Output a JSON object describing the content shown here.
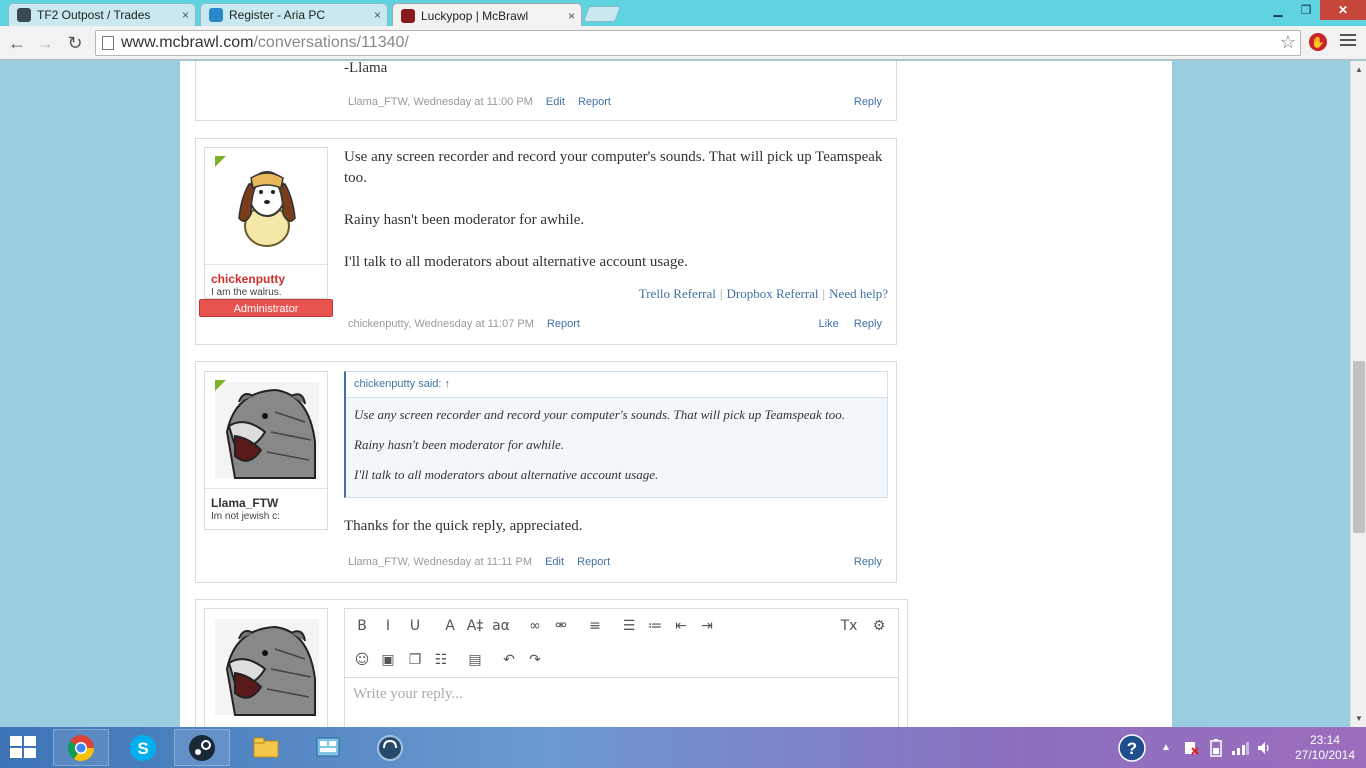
{
  "browser": {
    "tabs": [
      {
        "title": "TF2 Outpost / Trades",
        "active": false
      },
      {
        "title": "Register - Aria PC",
        "active": false
      },
      {
        "title": "Luckypop | McBrawl",
        "active": true
      }
    ],
    "tab_close_glyph": "×",
    "url_host": "www.mcbrawl.com",
    "url_path": "/conversations/11340/"
  },
  "posts": [
    {
      "body_tail": "-Llama",
      "meta_author_time": "Llama_FTW, Wednesday at 11:00 PM",
      "edit_label": "Edit",
      "report_label": "Report",
      "reply_label": "Reply"
    },
    {
      "username": "chickenputty",
      "user_title": "I am the walrus.",
      "user_badge": "Administrator",
      "paragraphs": [
        "Use any screen recorder and record your computer's sounds. That will pick up Teamspeak too.",
        "Rainy hasn't been moderator for awhile.",
        "I'll talk to all moderators about alternative account usage."
      ],
      "signature": [
        "Trello Referral",
        "Dropbox Referral",
        "Need help?"
      ],
      "signature_sep": "|",
      "meta_author_time": "chickenputty, Wednesday at 11:07 PM",
      "report_label": "Report",
      "like_label": "Like",
      "reply_label": "Reply"
    },
    {
      "username": "Llama_FTW",
      "user_title": "Im not jewish c:",
      "quote_author": "chickenputty said:",
      "quote_arrow": "↑",
      "quote_paragraphs": [
        "Use any screen recorder and record your computer's sounds. That will pick up Teamspeak too.",
        "Rainy hasn't been moderator for awhile.",
        "I'll talk to all moderators about alternative account usage."
      ],
      "body": "Thanks for the quick reply, appreciated.",
      "meta_author_time": "Llama_FTW, Wednesday at 11:11 PM",
      "edit_label": "Edit",
      "report_label": "Report",
      "reply_label": "Reply"
    }
  ],
  "editor": {
    "placeholder": "Write your reply...",
    "toolbar_row1": [
      {
        "name": "bold-icon",
        "glyph": "B"
      },
      {
        "name": "italic-icon",
        "glyph": "I"
      },
      {
        "name": "underline-icon",
        "glyph": "U"
      },
      {
        "name": "font-color-icon",
        "glyph": "A"
      },
      {
        "name": "font-size-icon",
        "glyph": "A‡"
      },
      {
        "name": "font-family-icon",
        "glyph": "aα"
      },
      {
        "name": "link-icon",
        "glyph": "∞"
      },
      {
        "name": "unlink-icon",
        "glyph": "⚮"
      },
      {
        "name": "align-icon",
        "glyph": "≡"
      },
      {
        "name": "bullet-list-icon",
        "glyph": "☰"
      },
      {
        "name": "numbered-list-icon",
        "glyph": "≔"
      },
      {
        "name": "outdent-icon",
        "glyph": "⇤"
      },
      {
        "name": "indent-icon",
        "glyph": "⇥"
      },
      {
        "name": "remove-format-icon",
        "glyph": "Tx"
      },
      {
        "name": "toggle-bbcode-icon",
        "glyph": "⚙"
      }
    ],
    "toolbar_row2": [
      {
        "name": "smilies-icon",
        "glyph": "☺"
      },
      {
        "name": "image-icon",
        "glyph": "▣"
      },
      {
        "name": "media-icon",
        "glyph": "❐"
      },
      {
        "name": "insert-icon",
        "glyph": "☷"
      },
      {
        "name": "save-draft-icon",
        "glyph": "▤"
      },
      {
        "name": "undo-icon",
        "glyph": "↶"
      },
      {
        "name": "redo-icon",
        "glyph": "↷"
      }
    ]
  },
  "taskbar": {
    "time": "23:14",
    "date": "27/10/2014",
    "apps": [
      "chrome-icon",
      "skype-icon",
      "steam-icon",
      "file-explorer-icon",
      "control-panel-icon",
      "teamspeak-icon"
    ]
  },
  "colors": {
    "link": "#3f71a6",
    "admin_name": "#d22d2d",
    "badge": "#e9534f",
    "tabstrip": "#5fd3df",
    "page_bg": "#9bcde0"
  }
}
